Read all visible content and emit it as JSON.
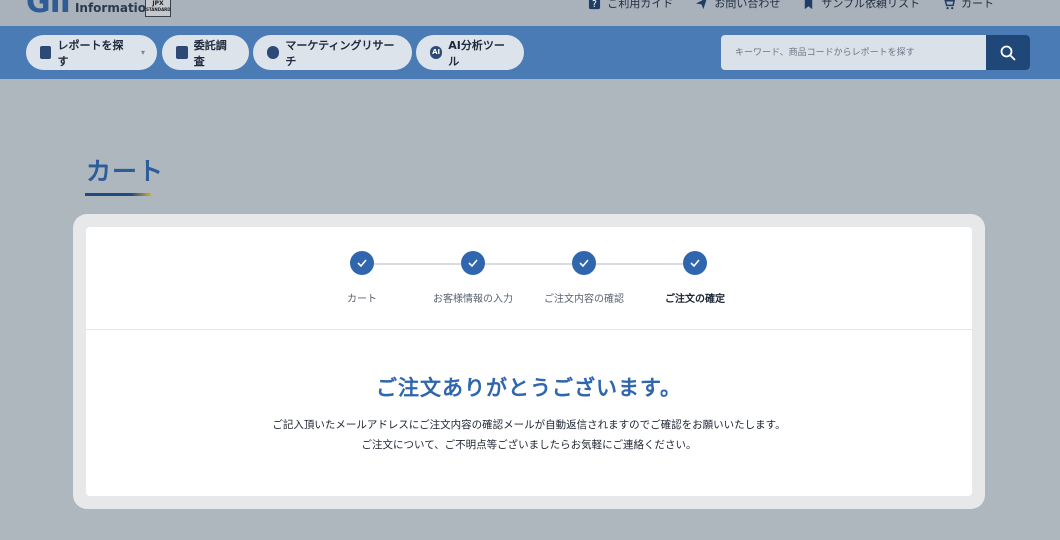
{
  "header": {
    "logo_mark": "GII",
    "logo_text": "Information",
    "badge_line1": "JPX",
    "badge_line2": "STANDARD",
    "utility_links": [
      {
        "label": "ご利用ガイド",
        "icon": "question-icon"
      },
      {
        "label": "お問い合わせ",
        "icon": "paper-plane-icon"
      },
      {
        "label": "サンプル依頼リスト",
        "icon": "bookmark-icon"
      },
      {
        "label": "カート",
        "icon": "cart-icon"
      }
    ]
  },
  "nav": {
    "items": [
      {
        "label": "レポートを探す",
        "icon": "report-icon"
      },
      {
        "label": "委託調査",
        "icon": "document-search-icon"
      },
      {
        "label": "マーケティングリサーチ",
        "icon": "chart-search-icon"
      },
      {
        "label": "AI分析ツール",
        "icon": "ai-icon"
      }
    ],
    "ai_icon_text": "AI",
    "search_placeholder": "キーワード、商品コードからレポートを探す"
  },
  "page": {
    "title": "カート"
  },
  "steps": [
    {
      "label": "カート",
      "done": true
    },
    {
      "label": "お客様情報の入力",
      "done": true
    },
    {
      "label": "ご注文内容の確認",
      "done": true
    },
    {
      "label": "ご注文の確定",
      "done": true,
      "active": true
    }
  ],
  "confirmation": {
    "heading": "ご注文ありがとうございます。",
    "message_line1": "ご記入頂いたメールアドレスにご注文内容の確認メールが自動返信されますのでご確認をお願いいたします。",
    "message_line2": "ご注文について、ご不明点等ございましたらお気軽にご連絡ください。"
  },
  "colors": {
    "primary": "#2f66ad",
    "nav_bg": "#4a7bb4",
    "search_button": "#1f4778",
    "overlay_bg": "#aeb6be"
  }
}
